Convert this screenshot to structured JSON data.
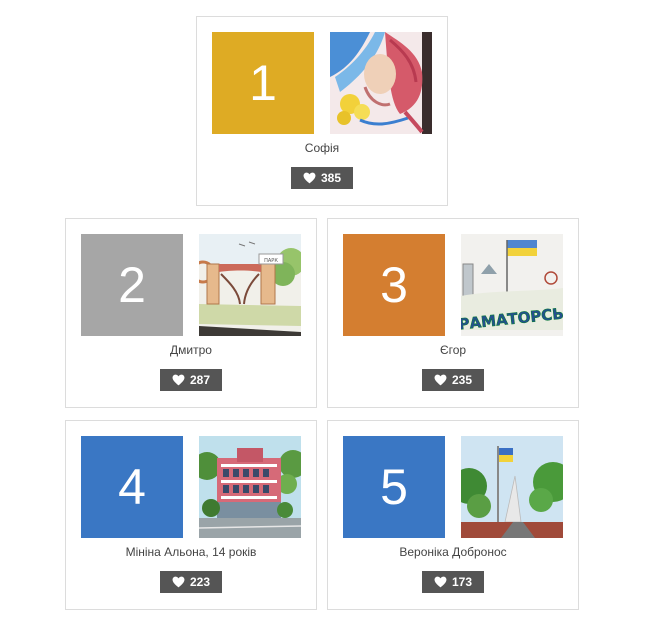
{
  "entries": [
    {
      "rank": "1",
      "name": "Софія",
      "likes": "385",
      "rank_color": "#deab24",
      "thumbnail": "painting-portrait"
    },
    {
      "rank": "2",
      "name": "Дмитро",
      "likes": "287",
      "rank_color": "#a6a6a6",
      "thumbnail": "drawing-park-gate"
    },
    {
      "rank": "3",
      "name": "Єгор",
      "likes": "235",
      "rank_color": "#d47e30",
      "thumbnail": "drawing-kramatorsk"
    },
    {
      "rank": "4",
      "name": "Мініна Альона, 14 років",
      "likes": "223",
      "rank_color": "#3a77c4",
      "thumbnail": "painting-building"
    },
    {
      "rank": "5",
      "name": "Вероніка Добронос",
      "likes": "173",
      "rank_color": "#3a77c4",
      "thumbnail": "painting-flag-monument"
    }
  ],
  "thumbnail_text": {
    "park_sign": "ПАРК",
    "kramatorsk": "КРАМАТОРСЬК"
  }
}
